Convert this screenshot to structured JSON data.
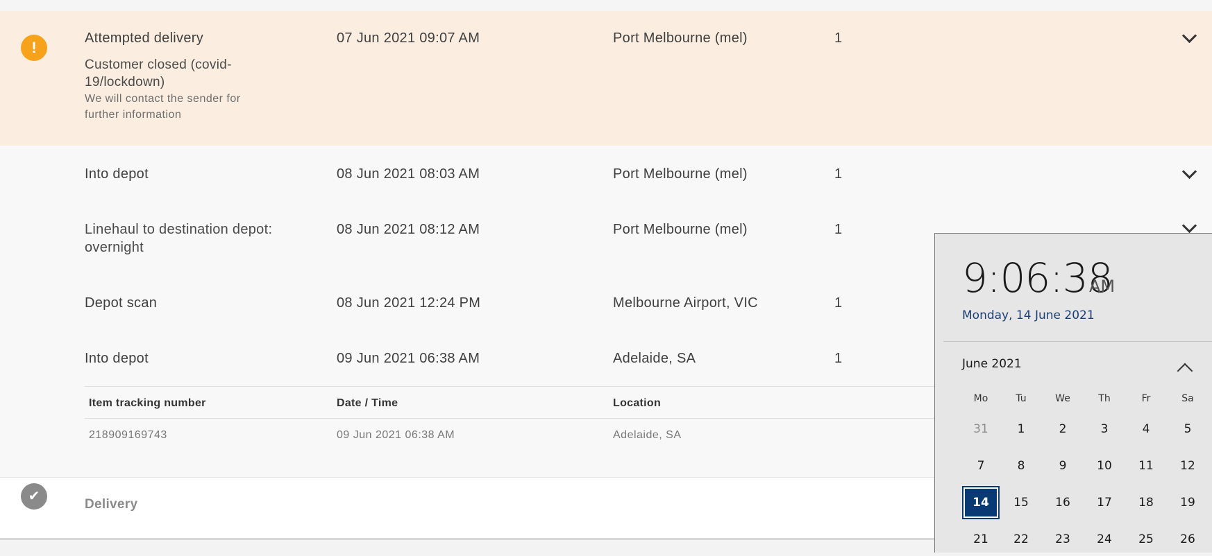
{
  "events": [
    {
      "status": "Attempted delivery",
      "date": "07 Jun 2021 09:07 AM",
      "location": "Port Melbourne (mel)",
      "items": "1",
      "detail": "Customer closed (covid-19/lockdown)",
      "note": "We will contact the sender for further information"
    },
    {
      "status": "Into depot",
      "date": "08 Jun 2021 08:03 AM",
      "location": "Port Melbourne (mel)",
      "items": "1"
    },
    {
      "status": "Linehaul to destination depot: overnight",
      "date": "08 Jun 2021 08:12 AM",
      "location": "Port Melbourne (mel)",
      "items": "1"
    },
    {
      "status": "Depot scan",
      "date": "08 Jun 2021 12:24 PM",
      "location": "Melbourne Airport, VIC",
      "items": "1"
    },
    {
      "status": "Into depot",
      "date": "09 Jun 2021 06:38 AM",
      "location": "Adelaide, SA",
      "items": "1"
    }
  ],
  "item_table": {
    "headers": [
      "Item tracking number",
      "Date / Time",
      "Location"
    ],
    "rows": [
      [
        "218909169743",
        "09 Jun 2021 06:38 AM",
        "Adelaide, SA"
      ]
    ]
  },
  "delivery": {
    "label": "Delivery"
  },
  "icons": {
    "warning": "exclamation-icon",
    "check": "check-icon",
    "expand": "chevron-down-icon"
  },
  "colors": {
    "attempted_bg": "#fbeee0",
    "warning": "#f7a21b",
    "today": "#0a3a73",
    "date_link": "#1c3f73"
  },
  "clock": {
    "time": "9:06:38",
    "ampm": "AM",
    "full_date": "Monday, 14 June 2021",
    "month_label": "June 2021",
    "weekdays": [
      "Mo",
      "Tu",
      "We",
      "Th",
      "Fr",
      "Sa"
    ],
    "weeks": [
      [
        "31",
        "1",
        "2",
        "3",
        "4",
        "5"
      ],
      [
        "7",
        "8",
        "9",
        "10",
        "11",
        "12"
      ],
      [
        "14",
        "15",
        "16",
        "17",
        "18",
        "19"
      ],
      [
        "21",
        "22",
        "23",
        "24",
        "25",
        "26"
      ]
    ],
    "today": "14"
  }
}
